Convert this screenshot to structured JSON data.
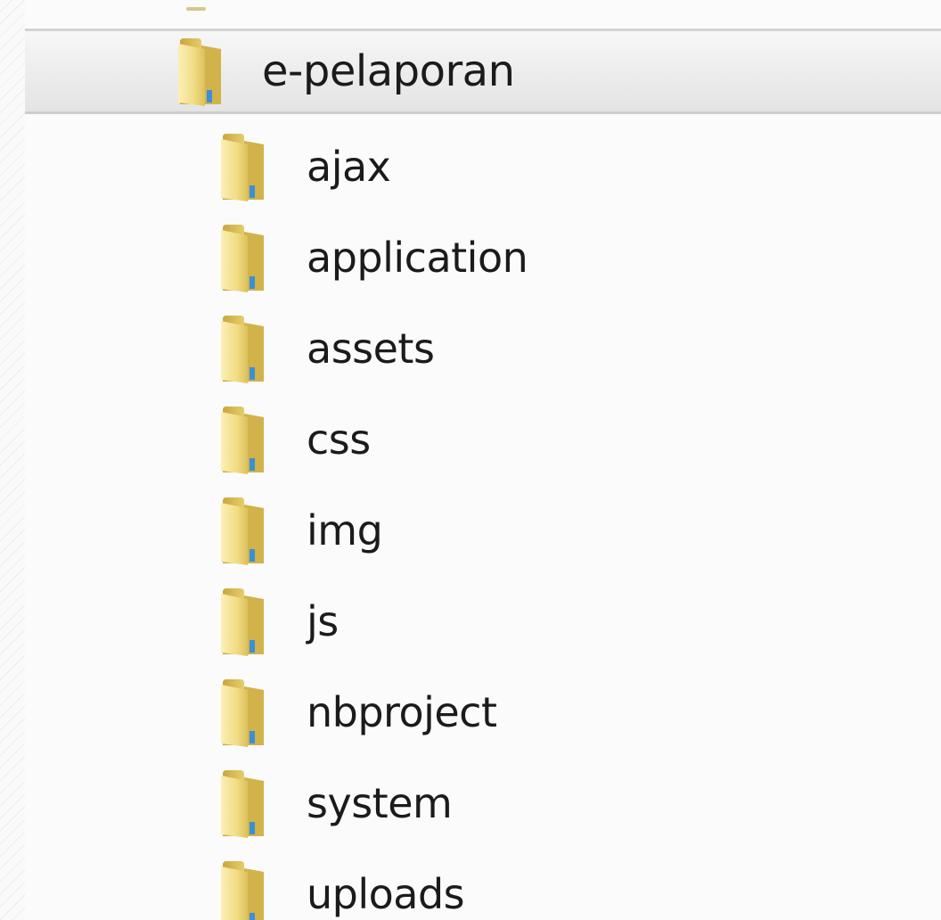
{
  "tree": {
    "root": {
      "label": "e-pelaporan",
      "icon": "folder-icon",
      "selected": true
    },
    "children": [
      {
        "label": "ajax",
        "icon": "folder-icon"
      },
      {
        "label": "application",
        "icon": "folder-icon"
      },
      {
        "label": "assets",
        "icon": "folder-icon"
      },
      {
        "label": "css",
        "icon": "folder-icon"
      },
      {
        "label": "img",
        "icon": "folder-icon"
      },
      {
        "label": "js",
        "icon": "folder-icon"
      },
      {
        "label": "nbproject",
        "icon": "folder-icon"
      },
      {
        "label": "system",
        "icon": "folder-icon"
      },
      {
        "label": "uploads",
        "icon": "folder-icon"
      }
    ]
  },
  "colors": {
    "folder_back": "#d8b94e",
    "folder_front": "#f3e08a",
    "folder_accent": "#3b8fd6",
    "selection_border": "#d3d3d3"
  }
}
